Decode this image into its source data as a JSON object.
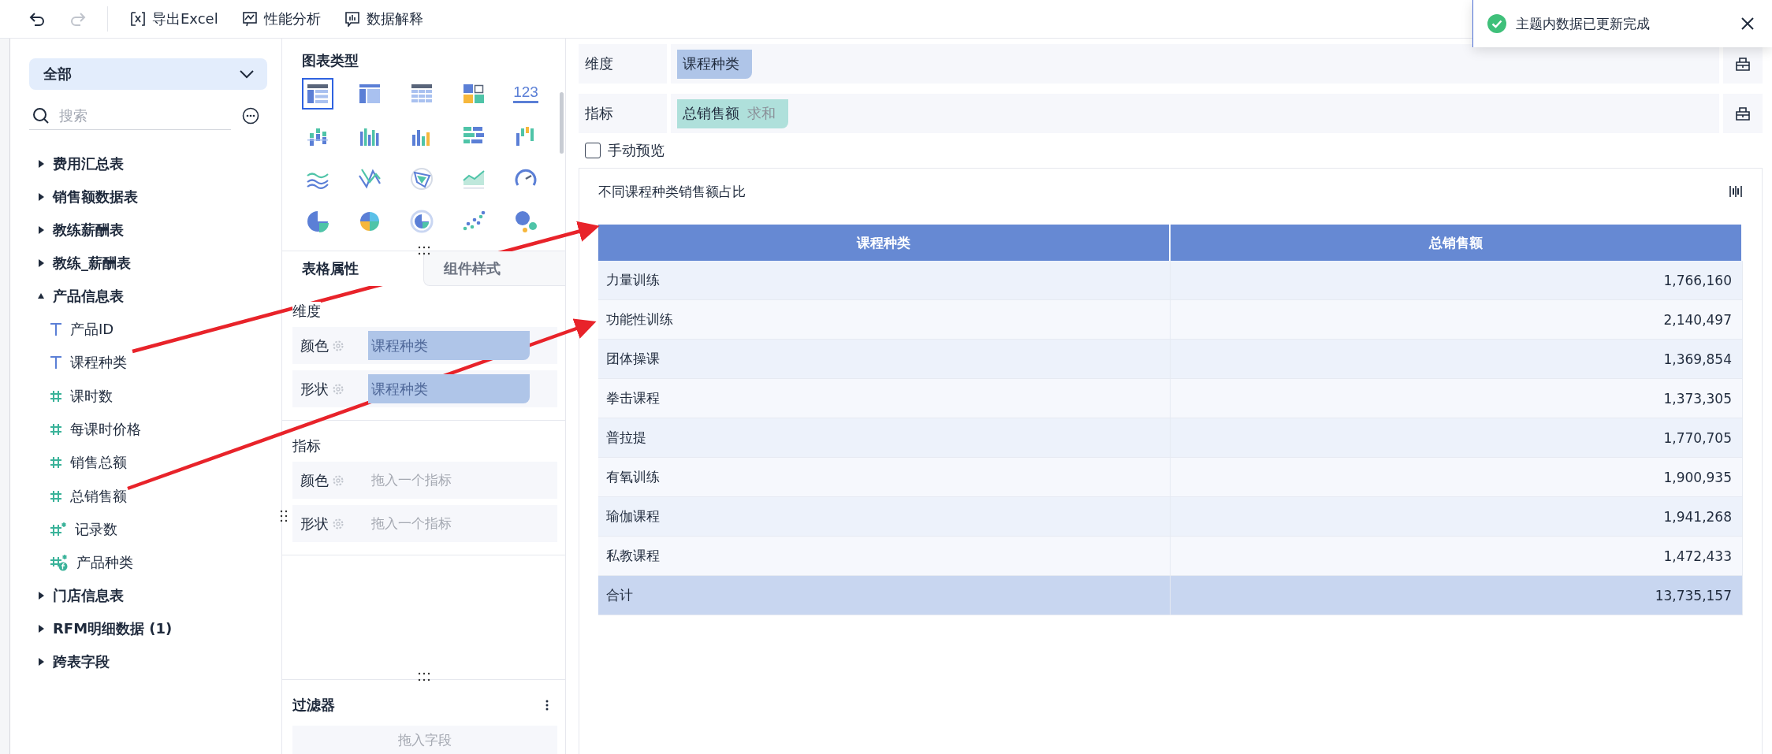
{
  "history": [
    {
      "kind": "undo",
      "disabled": false
    },
    {
      "kind": "redo",
      "disabled": true
    }
  ],
  "actions": [
    {
      "kind": "excel",
      "label": "导出Excel"
    },
    {
      "kind": "performance",
      "label": "性能分析"
    },
    {
      "kind": "explain",
      "label": "数据解释"
    }
  ],
  "toast": {
    "message": "主题内数据已更新完成"
  },
  "data_panel": {
    "scope": "全部",
    "search": {
      "placeholder": "搜索"
    },
    "tree": [
      {
        "label": "费用汇总表",
        "expanded": false
      },
      {
        "label": "销售额数据表",
        "expanded": false
      },
      {
        "label": "教练薪酬表",
        "expanded": false
      },
      {
        "label": "教练_薪酬表",
        "expanded": false
      },
      {
        "label": "产品信息表",
        "expanded": true,
        "children": [
          {
            "label": "产品ID",
            "kind": "text"
          },
          {
            "label": "课程种类",
            "kind": "text"
          },
          {
            "label": "课时数",
            "kind": "number"
          },
          {
            "label": "每课时价格",
            "kind": "number"
          },
          {
            "label": "销售总额",
            "kind": "number"
          },
          {
            "label": "总销售额",
            "kind": "number"
          },
          {
            "label": "记录数",
            "kind": "count"
          },
          {
            "label": "产品种类",
            "kind": "calc"
          }
        ]
      },
      {
        "label": "门店信息表",
        "expanded": false
      },
      {
        "label": "RFM明细数据 (1)",
        "expanded": false
      },
      {
        "label": "跨表字段",
        "expanded": false
      }
    ]
  },
  "chart_panel": {
    "title": "图表类型",
    "chart_types": [
      {
        "kind": "table",
        "selected": true
      },
      {
        "kind": "crosstab",
        "selected": false
      },
      {
        "kind": "detail",
        "selected": false
      },
      {
        "kind": "blocks",
        "selected": false
      },
      {
        "kind": "number",
        "label": "123",
        "selected": false
      },
      {
        "kind": "stacked",
        "selected": false
      },
      {
        "kind": "grouped",
        "selected": false
      },
      {
        "kind": "bars",
        "selected": false
      },
      {
        "kind": "hbars",
        "selected": false
      },
      {
        "kind": "waterfall",
        "selected": false
      },
      {
        "kind": "lines",
        "selected": false
      },
      {
        "kind": "polyline",
        "selected": false
      },
      {
        "kind": "radar",
        "selected": false
      },
      {
        "kind": "area",
        "selected": false
      },
      {
        "kind": "gauge",
        "selected": false
      },
      {
        "kind": "pie",
        "selected": false
      },
      {
        "kind": "rose",
        "selected": false
      },
      {
        "kind": "ring",
        "selected": false
      },
      {
        "kind": "scatter",
        "selected": false
      },
      {
        "kind": "bubble",
        "selected": false
      }
    ],
    "tabs": [
      {
        "label": "表格属性",
        "selected": true
      },
      {
        "label": "组件样式",
        "selected": false
      }
    ],
    "sections": [
      {
        "title": "维度",
        "slots": [
          {
            "label": "颜色",
            "value": "课程种类"
          },
          {
            "label": "形状",
            "value": "课程种类"
          }
        ]
      },
      {
        "title": "指标",
        "slots": [
          {
            "label": "颜色",
            "placeholder": "拖入一个指标"
          },
          {
            "label": "形状",
            "placeholder": "拖入一个指标"
          }
        ]
      }
    ],
    "filter": {
      "title": "过滤器",
      "placeholder": "拖入字段"
    }
  },
  "editor": {
    "rows": [
      {
        "label": "维度",
        "chips": [
          {
            "kind": "dimension",
            "name": "课程种类"
          }
        ]
      },
      {
        "label": "指标",
        "chips": [
          {
            "kind": "measure",
            "name": "总销售额",
            "aggregation": "求和"
          }
        ]
      }
    ],
    "manual_preview": {
      "label": "手动预览",
      "checked": false
    },
    "chart": {
      "title": "不同课程种类销售额占比",
      "columns": [
        "课程种类",
        "总销售额"
      ],
      "rows": [
        [
          "力量训练",
          "1,766,160"
        ],
        [
          "功能性训练",
          "2,140,497"
        ],
        [
          "团体操课",
          "1,369,854"
        ],
        [
          "拳击课程",
          "1,373,305"
        ],
        [
          "普拉提",
          "1,770,705"
        ],
        [
          "有氧训练",
          "1,900,935"
        ],
        [
          "瑜伽课程",
          "1,941,268"
        ],
        [
          "私教课程",
          "1,472,433"
        ]
      ],
      "total": [
        "合计",
        "13,735,157"
      ]
    }
  }
}
